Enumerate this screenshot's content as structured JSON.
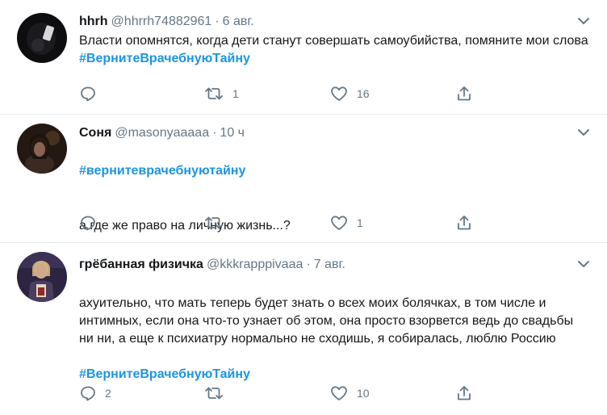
{
  "tweets": [
    {
      "name": "hhrh",
      "handle": "@hhrrh74882961",
      "separator": "·",
      "time": "6 авг.",
      "text": "Власти опомнятся, когда дети станут совершать самоубийства, помяните мои слова ",
      "hashtag": "#ВернитеВрачебнуюТайну",
      "actions": {
        "reply": "",
        "retweet": "1",
        "like": "16",
        "share": ""
      }
    },
    {
      "name": "Соня",
      "handle": "@masonyaaaaa",
      "separator": "·",
      "time": "10 ч",
      "hashtag": "#вернитеврачебнуютайну",
      "text": "а где же право на личную жизнь...?",
      "actions": {
        "reply": "",
        "retweet": "",
        "like": "1",
        "share": ""
      }
    },
    {
      "name": "грёбанная физичка",
      "handle": "@kkkrapppivaaa",
      "separator": "·",
      "time": "7 авг.",
      "text": "ахуительно, что мать теперь будет знать о всех моих болячках, в том числе и интимных, если она что-то узнает об этом, она просто взорвется ведь до свадьбы ни ни, а еще к психиатру нормально не сходишь, я собиралась, люблю Россию",
      "hashtag": "#ВернитеВрачебнуюТайну",
      "actions": {
        "reply": "2",
        "retweet": "",
        "like": "10",
        "share": ""
      }
    }
  ],
  "icons": {
    "reply": "reply-icon",
    "retweet": "retweet-icon",
    "like": "heart-icon",
    "share": "share-icon",
    "menu": "chevron-down-icon"
  },
  "colors": {
    "hashtag": "#1b95e0",
    "secondary_text": "#657786",
    "primary_text": "#14171a",
    "divider": "#e6ecf0"
  }
}
